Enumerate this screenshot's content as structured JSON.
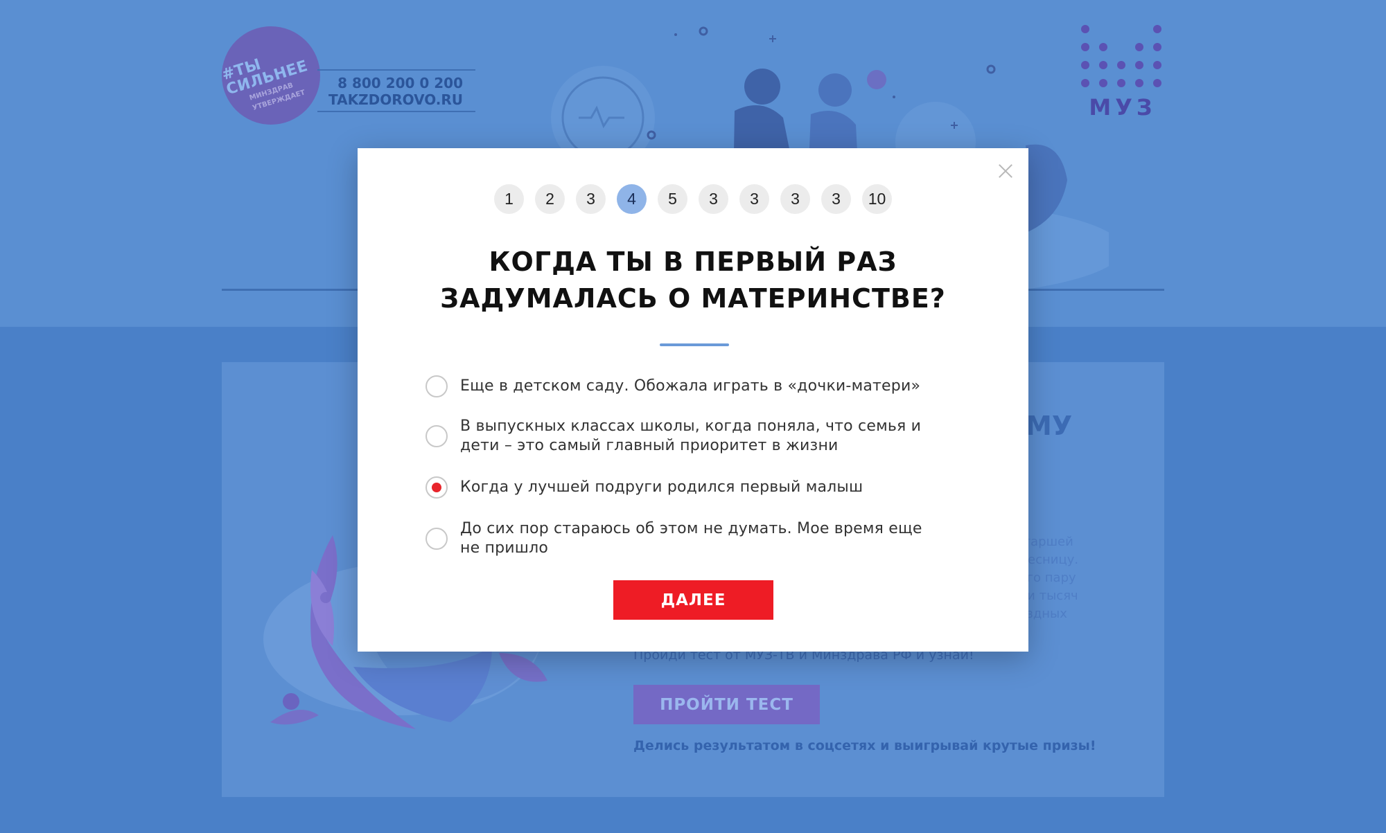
{
  "badge": {
    "hashtag_line1": "#ТЫ",
    "hashtag_line2": "СИЛЬНЕЕ",
    "sub_line1": "МИНЗДРАВ",
    "sub_line2": "УТВЕРЖДАЕТ"
  },
  "contact": {
    "phone": "8 800 200 0 200",
    "site": "TAKZDOROVO.RU"
  },
  "logo": {
    "text": "МУЗ",
    "color": "#5b52b3"
  },
  "card": {
    "heading_fragment": "МУ",
    "paragraph_lines": [
      "о старшей",
      "ровесницу.",
      "всего пару",
      "ятки тысяч",
      "звездных"
    ],
    "cta_text": "Пройди тест от МУЗ-ТВ и Минздрава РФ и узнай!",
    "button_label": "ПРОЙТИ ТЕСТ",
    "share_text": "Делись результатом в соцсетях и выигрывай крутые призы!"
  },
  "quiz": {
    "steps": [
      "1",
      "2",
      "3",
      "4",
      "5",
      "3",
      "3",
      "3",
      "3",
      "10"
    ],
    "active_step_index": 3,
    "question_line1": "КОГДА ТЫ В ПЕРВЫЙ РАЗ",
    "question_line2": "ЗАДУМАЛАСЬ О МАТЕРИНСТВЕ?",
    "options": [
      {
        "lines": [
          "Еще в детском саду. Обожала играть в «дочки-матери»"
        ],
        "selected": false
      },
      {
        "lines": [
          "В выпускных классах школы, когда поняла, что семья и",
          "дети – это самый главный приоритет в жизни"
        ],
        "selected": false
      },
      {
        "lines": [
          "Когда у лучшей подруги родился первый малыш"
        ],
        "selected": true
      },
      {
        "lines": [
          "До сих пор стараюсь об этом не думать. Мое время еще",
          "не пришло"
        ],
        "selected": false
      }
    ],
    "next_label": "ДАЛЕЕ",
    "accent_color": "#ee1c25",
    "active_step_color": "#8fb4e8"
  },
  "icons": {
    "close": "close-icon",
    "radio": "radio-icon"
  }
}
